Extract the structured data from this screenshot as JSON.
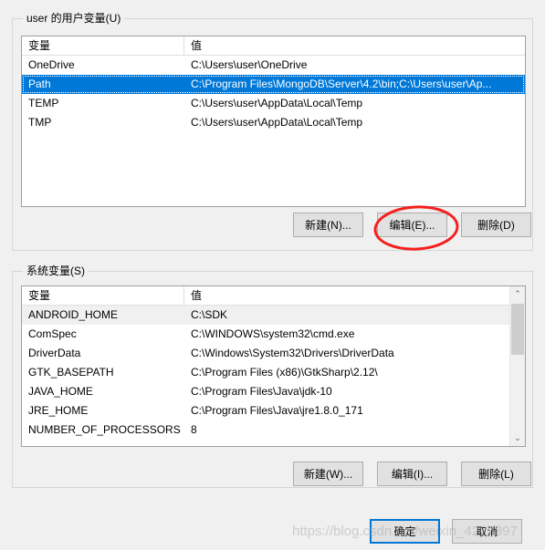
{
  "dialog": {
    "background_color": "#f0f0f0",
    "accent_color": "#0078d7"
  },
  "user_section": {
    "group_label": "user 的用户变量(U)",
    "columns": [
      "变量",
      "值"
    ],
    "rows": [
      {
        "name": "OneDrive",
        "value": "C:\\Users\\user\\OneDrive",
        "selected": false
      },
      {
        "name": "Path",
        "value": "C:\\Program Files\\MongoDB\\Server\\4.2\\bin;C:\\Users\\user\\Ap...",
        "selected": true
      },
      {
        "name": "TEMP",
        "value": "C:\\Users\\user\\AppData\\Local\\Temp",
        "selected": false
      },
      {
        "name": "TMP",
        "value": "C:\\Users\\user\\AppData\\Local\\Temp",
        "selected": false
      }
    ],
    "buttons": {
      "new": "新建(N)...",
      "edit": "编辑(E)...",
      "delete": "删除(D)"
    }
  },
  "system_section": {
    "group_label": "系统变量(S)",
    "columns": [
      "变量",
      "值"
    ],
    "rows": [
      {
        "name": "ANDROID_HOME",
        "value": "C:\\SDK",
        "soft_selected": true
      },
      {
        "name": "ComSpec",
        "value": "C:\\WINDOWS\\system32\\cmd.exe",
        "soft_selected": false
      },
      {
        "name": "DriverData",
        "value": "C:\\Windows\\System32\\Drivers\\DriverData",
        "soft_selected": false
      },
      {
        "name": "GTK_BASEPATH",
        "value": "C:\\Program Files (x86)\\GtkSharp\\2.12\\",
        "soft_selected": false
      },
      {
        "name": "JAVA_HOME",
        "value": "C:\\Program Files\\Java\\jdk-10",
        "soft_selected": false
      },
      {
        "name": "JRE_HOME",
        "value": "C:\\Program Files\\Java\\jre1.8.0_171",
        "soft_selected": false
      },
      {
        "name": "NUMBER_OF_PROCESSORS",
        "value": "8",
        "soft_selected": false
      }
    ],
    "buttons": {
      "new": "新建(W)...",
      "edit": "编辑(I)...",
      "delete": "删除(L)"
    },
    "scrollbar": {
      "up_arrow": "⌃",
      "down_arrow": "⌄"
    }
  },
  "footer": {
    "ok": "确定",
    "cancel": "取消"
  },
  "annotation": {
    "shape": "red-ellipse",
    "color": "#f4201f",
    "target": "编辑(E)..."
  },
  "watermark": {
    "text": "https://blog.csdn.net/weixin_42?5897"
  }
}
